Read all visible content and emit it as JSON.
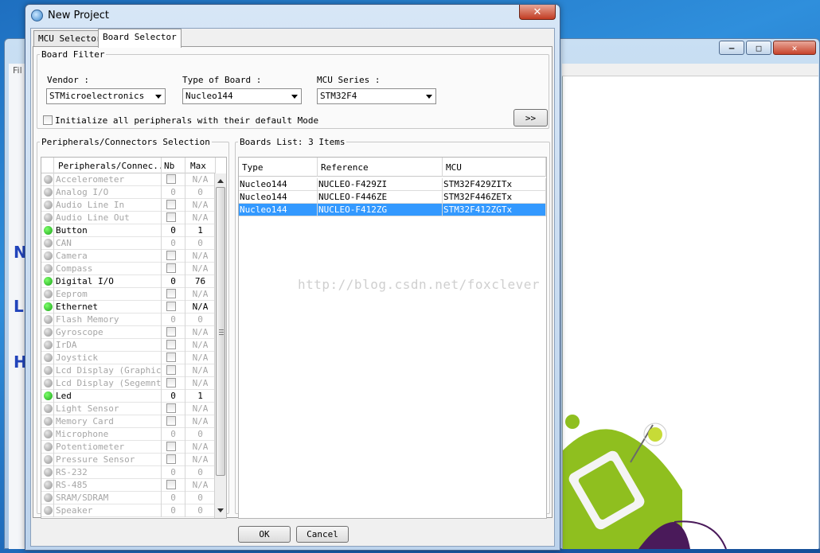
{
  "background_window": {
    "menu_stub": "Fil",
    "left_letters": [
      "N",
      "L",
      "H"
    ]
  },
  "dialog": {
    "title": "New Project",
    "close_glyph": "✕",
    "tabs": [
      {
        "label": "MCU Selector",
        "active": false
      },
      {
        "label": "Board Selector",
        "active": true
      }
    ],
    "board_filter": {
      "legend": "Board Filter",
      "vendor": {
        "label": "Vendor :",
        "value": "STMicroelectronics"
      },
      "type_of_board": {
        "label": "Type of Board :",
        "value": "Nucleo144"
      },
      "mcu_series": {
        "label": "MCU Series :",
        "value": "STM32F4"
      },
      "init_checkbox_label": "Initialize all peripherals with their default Mode",
      "expand_button": ">>"
    },
    "peripherals": {
      "legend": "Peripherals/Connectors Selection",
      "headers": [
        "Peripherals/Connec...",
        "Nb",
        "Max"
      ],
      "rows": [
        {
          "name": "Accelerometer",
          "nb": "",
          "max": "N/A",
          "enabled": false,
          "checkbox": true
        },
        {
          "name": "Analog I/O",
          "nb": "0",
          "max": "0",
          "enabled": false,
          "checkbox": false
        },
        {
          "name": "Audio Line In",
          "nb": "",
          "max": "N/A",
          "enabled": false,
          "checkbox": true
        },
        {
          "name": "Audio Line Out",
          "nb": "",
          "max": "N/A",
          "enabled": false,
          "checkbox": true
        },
        {
          "name": "Button",
          "nb": "0",
          "max": "1",
          "enabled": true,
          "checkbox": false
        },
        {
          "name": "CAN",
          "nb": "0",
          "max": "0",
          "enabled": false,
          "checkbox": false
        },
        {
          "name": "Camera",
          "nb": "",
          "max": "N/A",
          "enabled": false,
          "checkbox": true
        },
        {
          "name": "Compass",
          "nb": "",
          "max": "N/A",
          "enabled": false,
          "checkbox": true
        },
        {
          "name": "Digital I/O",
          "nb": "0",
          "max": "76",
          "enabled": true,
          "checkbox": false
        },
        {
          "name": "Eeprom",
          "nb": "",
          "max": "N/A",
          "enabled": false,
          "checkbox": true
        },
        {
          "name": "Ethernet",
          "nb": "",
          "max": "N/A",
          "enabled": true,
          "checkbox": true
        },
        {
          "name": "Flash Memory",
          "nb": "0",
          "max": "0",
          "enabled": false,
          "checkbox": false
        },
        {
          "name": "Gyroscope",
          "nb": "",
          "max": "N/A",
          "enabled": false,
          "checkbox": true
        },
        {
          "name": "IrDA",
          "nb": "",
          "max": "N/A",
          "enabled": false,
          "checkbox": true
        },
        {
          "name": "Joystick",
          "nb": "",
          "max": "N/A",
          "enabled": false,
          "checkbox": true
        },
        {
          "name": "Lcd Display (Graphics)",
          "nb": "",
          "max": "N/A",
          "enabled": false,
          "checkbox": true
        },
        {
          "name": "Lcd Display (Segemnt)",
          "nb": "",
          "max": "N/A",
          "enabled": false,
          "checkbox": true
        },
        {
          "name": "Led",
          "nb": "0",
          "max": "1",
          "enabled": true,
          "checkbox": false
        },
        {
          "name": "Light Sensor",
          "nb": "",
          "max": "N/A",
          "enabled": false,
          "checkbox": true
        },
        {
          "name": "Memory Card",
          "nb": "",
          "max": "N/A",
          "enabled": false,
          "checkbox": true
        },
        {
          "name": "Microphone",
          "nb": "0",
          "max": "0",
          "enabled": false,
          "checkbox": false
        },
        {
          "name": "Potentiometer",
          "nb": "",
          "max": "N/A",
          "enabled": false,
          "checkbox": true
        },
        {
          "name": "Pressure Sensor",
          "nb": "",
          "max": "N/A",
          "enabled": false,
          "checkbox": true
        },
        {
          "name": "RS-232",
          "nb": "0",
          "max": "0",
          "enabled": false,
          "checkbox": false
        },
        {
          "name": "RS-485",
          "nb": "",
          "max": "N/A",
          "enabled": false,
          "checkbox": true
        },
        {
          "name": "SRAM/SDRAM",
          "nb": "0",
          "max": "0",
          "enabled": false,
          "checkbox": false
        },
        {
          "name": "Speaker",
          "nb": "0",
          "max": "0",
          "enabled": false,
          "checkbox": false
        }
      ]
    },
    "boards": {
      "legend": "Boards List: 3 Items",
      "headers": [
        "Type",
        "Reference",
        "MCU"
      ],
      "rows": [
        {
          "type": "Nucleo144",
          "reference": "NUCLEO-F429ZI",
          "mcu": "STM32F429ZITx",
          "selected": false
        },
        {
          "type": "Nucleo144",
          "reference": "NUCLEO-F446ZE",
          "mcu": "STM32F446ZETx",
          "selected": false
        },
        {
          "type": "Nucleo144",
          "reference": "NUCLEO-F412ZG",
          "mcu": "STM32F412ZGTx",
          "selected": true
        }
      ]
    },
    "watermark": "http://blog.csdn.net/foxclever",
    "ok_label": "OK",
    "cancel_label": "Cancel"
  },
  "colors": {
    "selection": "#3399ff",
    "status_on": "#1ca31a",
    "status_off": "#8f8f8f"
  }
}
